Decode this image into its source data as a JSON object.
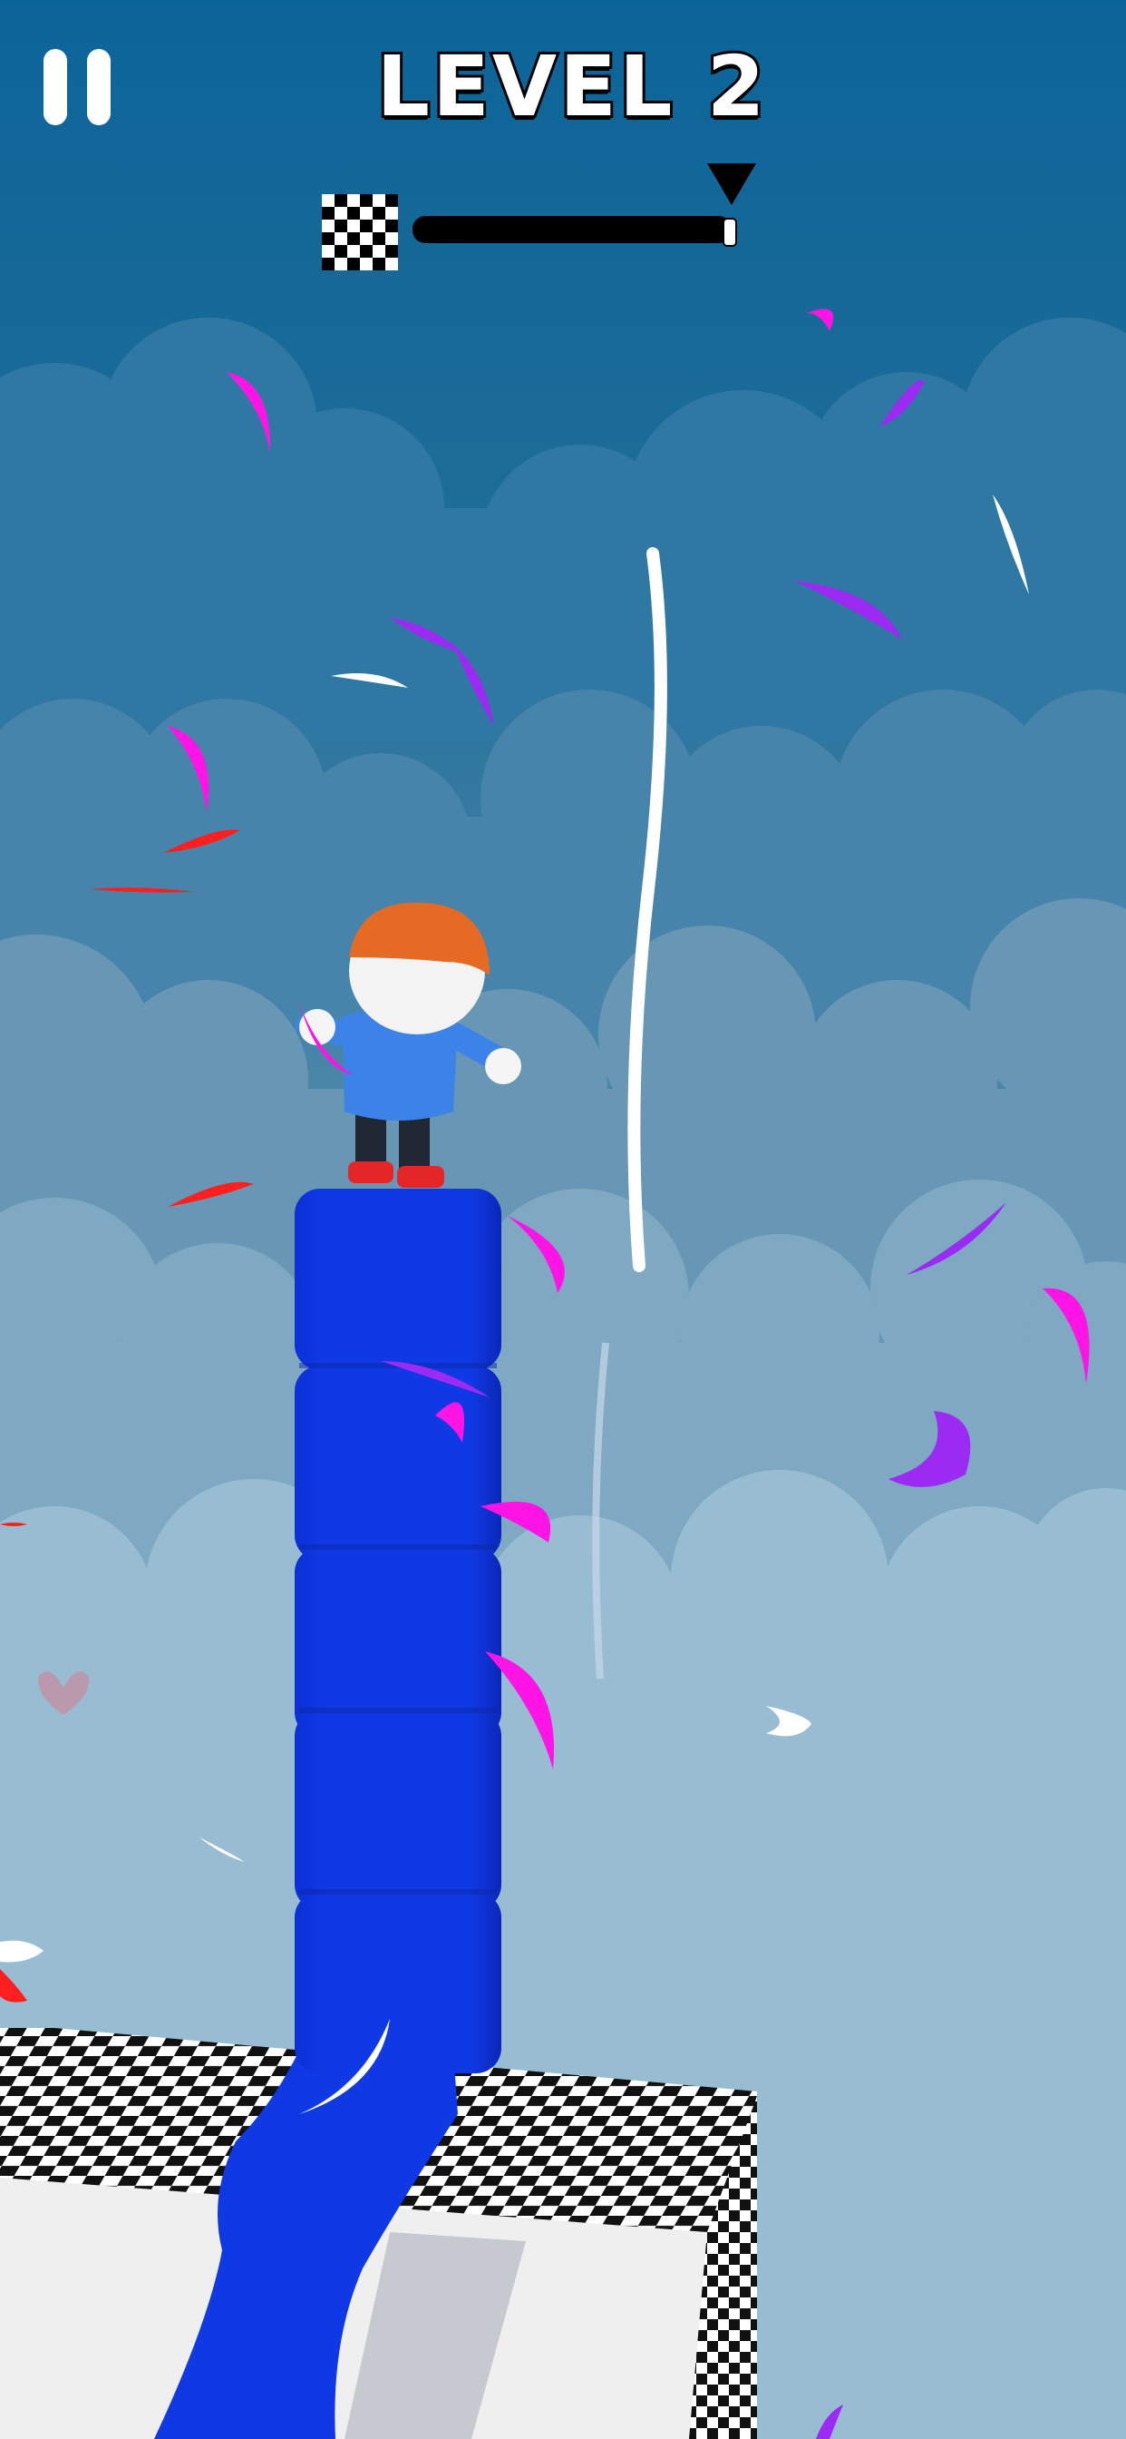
{
  "hud": {
    "pause_icon": "pause-icon",
    "level_label": "LEVEL 2",
    "progress": {
      "value": 1.0,
      "start_icon": "checkered-flag-icon",
      "marker_icon": "triangle-pointer-icon"
    }
  },
  "scene": {
    "sky_top": "#0b6499",
    "sky_bottom": "#a1c4d7",
    "cube_color": "#1039e6",
    "cube_count": 5,
    "confetti_colors": [
      "#ff14e6",
      "#9b2bf2",
      "#ff1f1f",
      "#ffffff"
    ]
  }
}
